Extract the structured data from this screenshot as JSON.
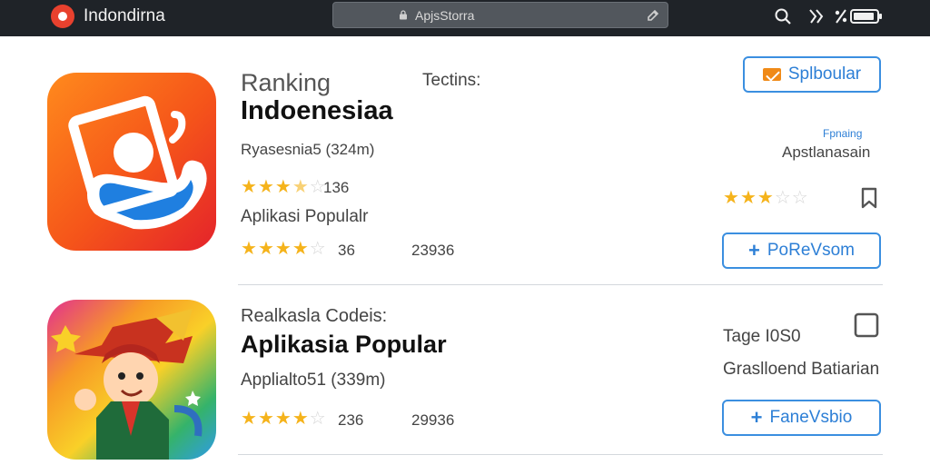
{
  "topbar": {
    "brand_name": "Indondirna",
    "url_text": "ApjsStorra",
    "icons": [
      "brand-logo-icon",
      "lock-icon",
      "edit-icon",
      "search-icon",
      "signal-icon",
      "wifi-icon",
      "battery-icon"
    ]
  },
  "apps": [
    {
      "label": "Ranking",
      "title": "Indoenesiaa",
      "size_text": "Ryasesnia5 (324m)",
      "rating_count": "136",
      "subtitle": "Aplikasi Populalr",
      "stars_top": 3.5,
      "stars_bottom": 4,
      "rating_count_2": "36",
      "downloads": "23936",
      "section_label": "Tectins:",
      "badge_button": "Splboular",
      "tag_small": "Fpnaing",
      "right_text": "Apstlanasain",
      "right_stars": 3,
      "action_button": "PoReVsom",
      "icon_colors": [
        "#ff6a13",
        "#e82a2a",
        "#1d7be0",
        "#ffffff"
      ]
    },
    {
      "label": "Realkasla Codeis:",
      "title": "Aplikasia Popular",
      "size_text": "Applialto51 (339m)",
      "stars_bottom": 4,
      "rating_count_2": "236",
      "downloads": "29936",
      "tag_right": "Tage I0S0",
      "right_text": "Graslloend Batiarian",
      "action_button": "FaneVsbio",
      "icon_colors": [
        "#e2308f",
        "#f9d028",
        "#2f9be8",
        "#2ca34b"
      ]
    }
  ]
}
